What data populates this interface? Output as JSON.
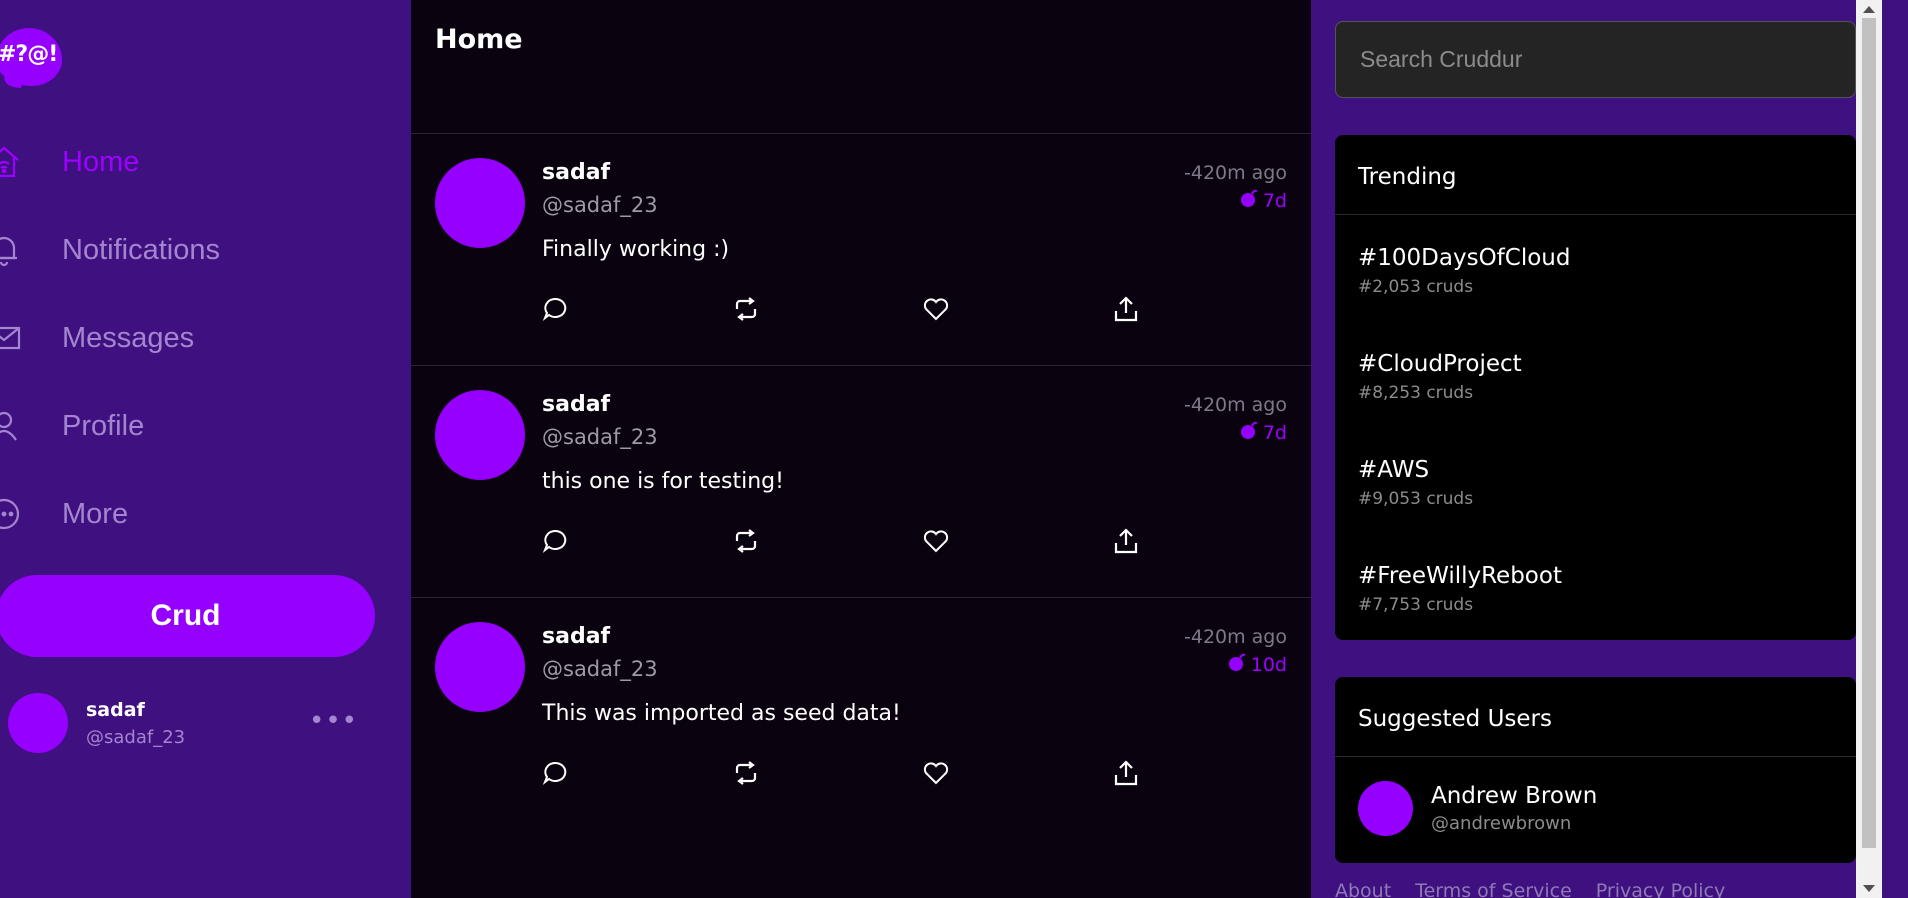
{
  "logo": {
    "text": "#?@!"
  },
  "sidebar": {
    "items": [
      {
        "label": "Home",
        "icon": "home-icon",
        "active": true
      },
      {
        "label": "Notifications",
        "icon": "bell-icon",
        "active": false
      },
      {
        "label": "Messages",
        "icon": "envelope-icon",
        "active": false
      },
      {
        "label": "Profile",
        "icon": "person-icon",
        "active": false
      },
      {
        "label": "More",
        "icon": "more-circle-icon",
        "active": false
      }
    ],
    "crud_button": "Crud",
    "profile": {
      "name": "sadaf",
      "handle": "@sadaf_23",
      "more": "•••"
    }
  },
  "feed": {
    "title": "Home",
    "activities": [
      {
        "name": "sadaf",
        "handle": "@sadaf_23",
        "time": "-420m ago",
        "expires": "7d",
        "message": "Finally working :)"
      },
      {
        "name": "sadaf",
        "handle": "@sadaf_23",
        "time": "-420m ago",
        "expires": "7d",
        "message": "this one is for testing!"
      },
      {
        "name": "sadaf",
        "handle": "@sadaf_23",
        "time": "-420m ago",
        "expires": "10d",
        "message": "This was imported as seed data!"
      }
    ]
  },
  "search": {
    "placeholder": "Search Cruddur"
  },
  "trending": {
    "title": "Trending",
    "items": [
      {
        "tag": "#100DaysOfCloud",
        "count": "#2,053 cruds"
      },
      {
        "tag": "#CloudProject",
        "count": "#8,253 cruds"
      },
      {
        "tag": "#AWS",
        "count": "#9,053 cruds"
      },
      {
        "tag": "#FreeWillyReboot",
        "count": "#7,753 cruds"
      }
    ]
  },
  "suggested": {
    "title": "Suggested Users",
    "users": [
      {
        "name": "Andrew Brown",
        "handle": "@andrewbrown"
      }
    ]
  },
  "footer": {
    "links": [
      "About",
      "Terms of Service",
      "Privacy Policy"
    ]
  },
  "colors": {
    "accent": "#9500ff",
    "sidebar_bg": "#3f1080",
    "feed_bg": "#0a020e"
  }
}
